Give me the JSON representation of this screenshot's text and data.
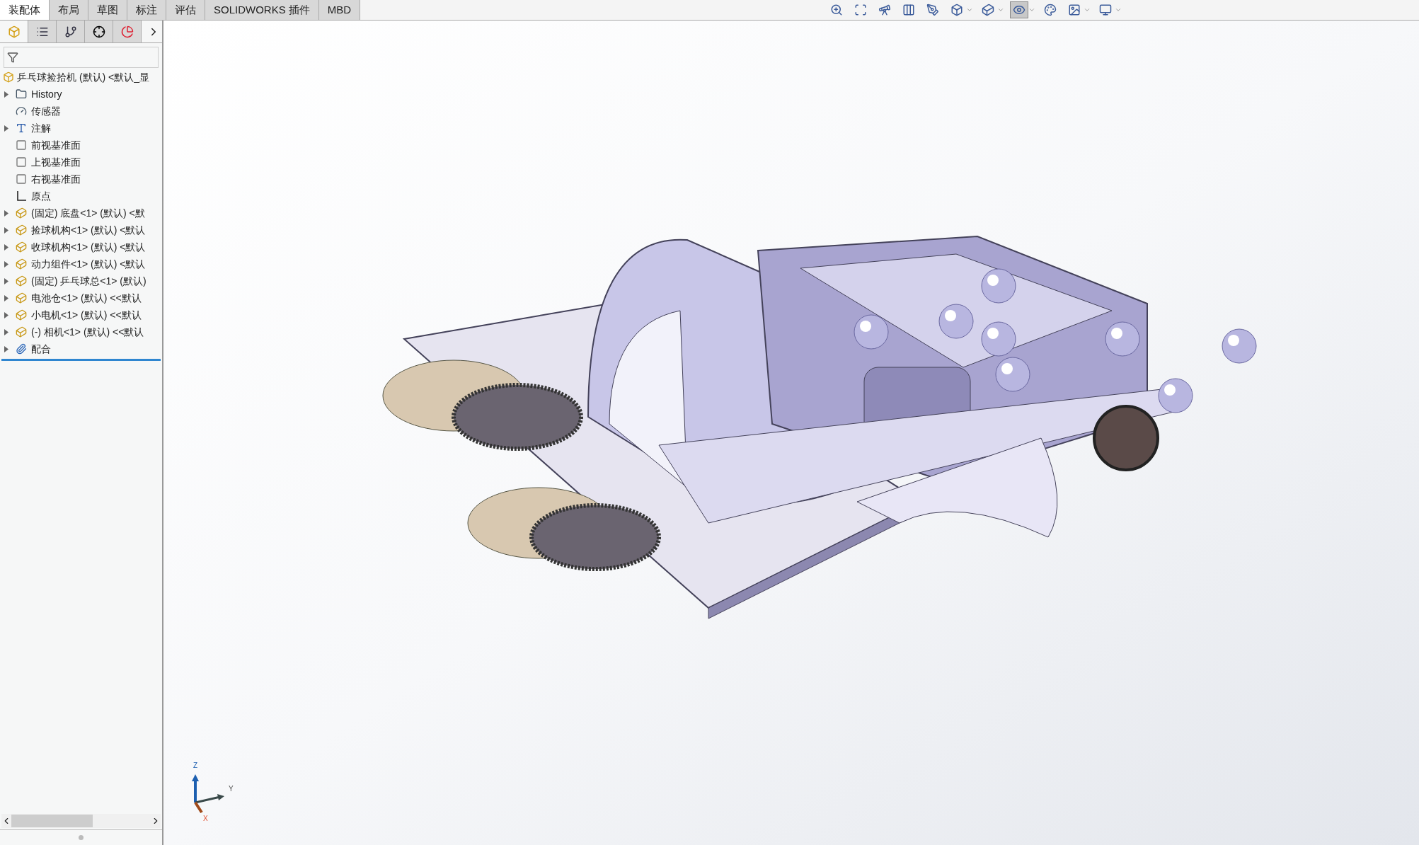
{
  "command_tabs": [
    {
      "label": "装配体",
      "selected": true
    },
    {
      "label": "布局",
      "selected": false
    },
    {
      "label": "草图",
      "selected": false
    },
    {
      "label": "标注",
      "selected": false
    },
    {
      "label": "评估",
      "selected": false
    },
    {
      "label": "SOLIDWORKS 插件",
      "selected": false
    },
    {
      "label": "MBD",
      "selected": false
    }
  ],
  "view_toolbar": [
    {
      "kind": "zoom-fit",
      "selected": false,
      "dropdown": false
    },
    {
      "kind": "zoom-area",
      "selected": false,
      "dropdown": false
    },
    {
      "kind": "previous-view",
      "selected": false,
      "dropdown": false
    },
    {
      "kind": "section-view",
      "selected": false,
      "dropdown": false
    },
    {
      "kind": "dynamic-annotation",
      "selected": false,
      "dropdown": false
    },
    {
      "kind": "view-orientation",
      "selected": false,
      "dropdown": true
    },
    {
      "kind": "display-style",
      "selected": false,
      "dropdown": true
    },
    {
      "kind": "hide-show",
      "selected": true,
      "dropdown": true
    },
    {
      "kind": "edit-appearance",
      "selected": false,
      "dropdown": false
    },
    {
      "kind": "apply-scene",
      "selected": false,
      "dropdown": true
    },
    {
      "kind": "view-settings",
      "selected": false,
      "dropdown": true
    }
  ],
  "panel_tabs": [
    {
      "kind": "feature-manager",
      "selected": true
    },
    {
      "kind": "property-manager",
      "selected": false
    },
    {
      "kind": "configuration-manager",
      "selected": false
    },
    {
      "kind": "dimxpert",
      "selected": false
    },
    {
      "kind": "display-manager",
      "selected": false
    }
  ],
  "tree": {
    "root": "乒乓球捡拾机 (默认) <默认_显",
    "items": [
      {
        "kind": "history",
        "label": "History",
        "expandable": true
      },
      {
        "kind": "sensor",
        "label": "传感器",
        "expandable": false
      },
      {
        "kind": "annotation",
        "label": "注解",
        "expandable": true
      },
      {
        "kind": "plane",
        "label": "前视基准面",
        "expandable": false
      },
      {
        "kind": "plane",
        "label": "上视基准面",
        "expandable": false
      },
      {
        "kind": "plane",
        "label": "右视基准面",
        "expandable": false
      },
      {
        "kind": "origin",
        "label": "原点",
        "expandable": false
      },
      {
        "kind": "component",
        "label": "(固定) 底盘<1> (默认) <默",
        "expandable": true
      },
      {
        "kind": "component",
        "label": "捡球机构<1> (默认) <默认",
        "expandable": true
      },
      {
        "kind": "component",
        "label": "收球机构<1> (默认) <默认",
        "expandable": true
      },
      {
        "kind": "component",
        "label": "动力组件<1> (默认) <默认",
        "expandable": true
      },
      {
        "kind": "component",
        "label": "(固定) 乒乓球总<1> (默认)",
        "expandable": true
      },
      {
        "kind": "component",
        "label": "电池仓<1> (默认) <<默认",
        "expandable": true
      },
      {
        "kind": "component",
        "label": "小电机<1> (默认) <<默认",
        "expandable": true
      },
      {
        "kind": "component",
        "label": "(-) 相机<1> (默认) <<默认",
        "expandable": true
      },
      {
        "kind": "mates",
        "label": "配合",
        "expandable": true
      }
    ]
  },
  "triad": {
    "z": "Z",
    "y": "Y",
    "x": "X"
  }
}
